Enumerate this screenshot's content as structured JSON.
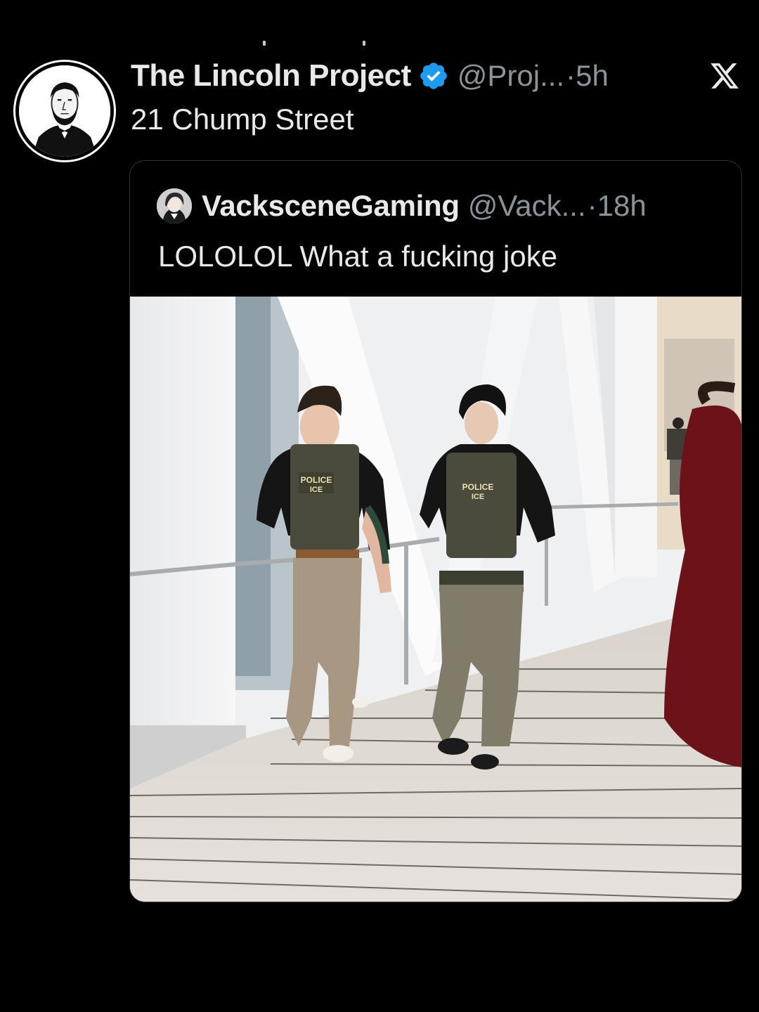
{
  "tweet": {
    "display_name": "The Lincoln Project",
    "handle": "@Proj...",
    "separator": "·",
    "time": "5h",
    "text": "21 Chump Street",
    "verified": true,
    "avatar_icon": "lincoln-portrait-icon"
  },
  "quote": {
    "display_name": "VacksceneGaming",
    "handle": "@Vack...",
    "separator": "·",
    "time": "18h",
    "text": "LOLOLOL What a fucking joke",
    "avatar_icon": "anime-character-avatar-icon",
    "image": {
      "patch_text": "POLICE",
      "patch_subtext": "ICE"
    }
  },
  "app": {
    "logo_icon": "x-logo-icon",
    "verified_color": "#1d9bf0",
    "text_color": "#e7e9ea",
    "muted_color": "#8b9299",
    "background": "#000000",
    "border_color": "#2f3336"
  }
}
